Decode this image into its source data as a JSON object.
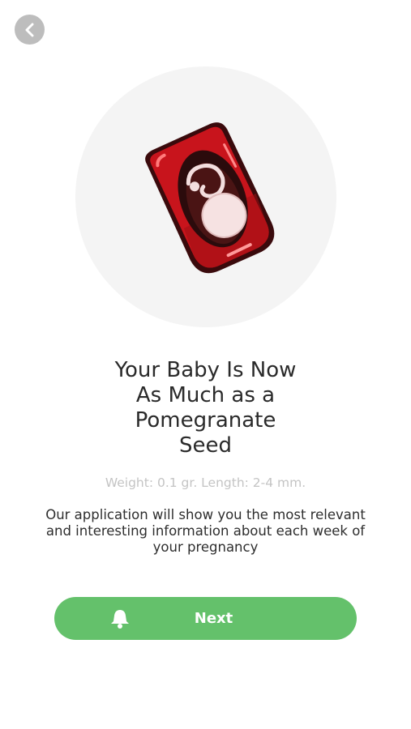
{
  "header": {
    "back_icon": "chevron-left-icon"
  },
  "hero": {
    "illustration": "fetus-in-pomegranate-seed"
  },
  "title_lines": [
    "Your Baby Is Now",
    "As Much as a",
    "Pomegranate",
    "Seed"
  ],
  "measurements": "Weight: 0.1 gr. Length: 2-4 mm.",
  "description_lines": [
    "Our application will show you the most relevant",
    "and interesting information about each week of",
    "your pregnancy"
  ],
  "next_button": {
    "label": "Next",
    "icon": "bell-icon"
  },
  "colors": {
    "accent": "#64c16b",
    "seed_red": "#c8141c",
    "back_button": "#bdbdbd",
    "circle_bg": "#f4f4f4"
  }
}
